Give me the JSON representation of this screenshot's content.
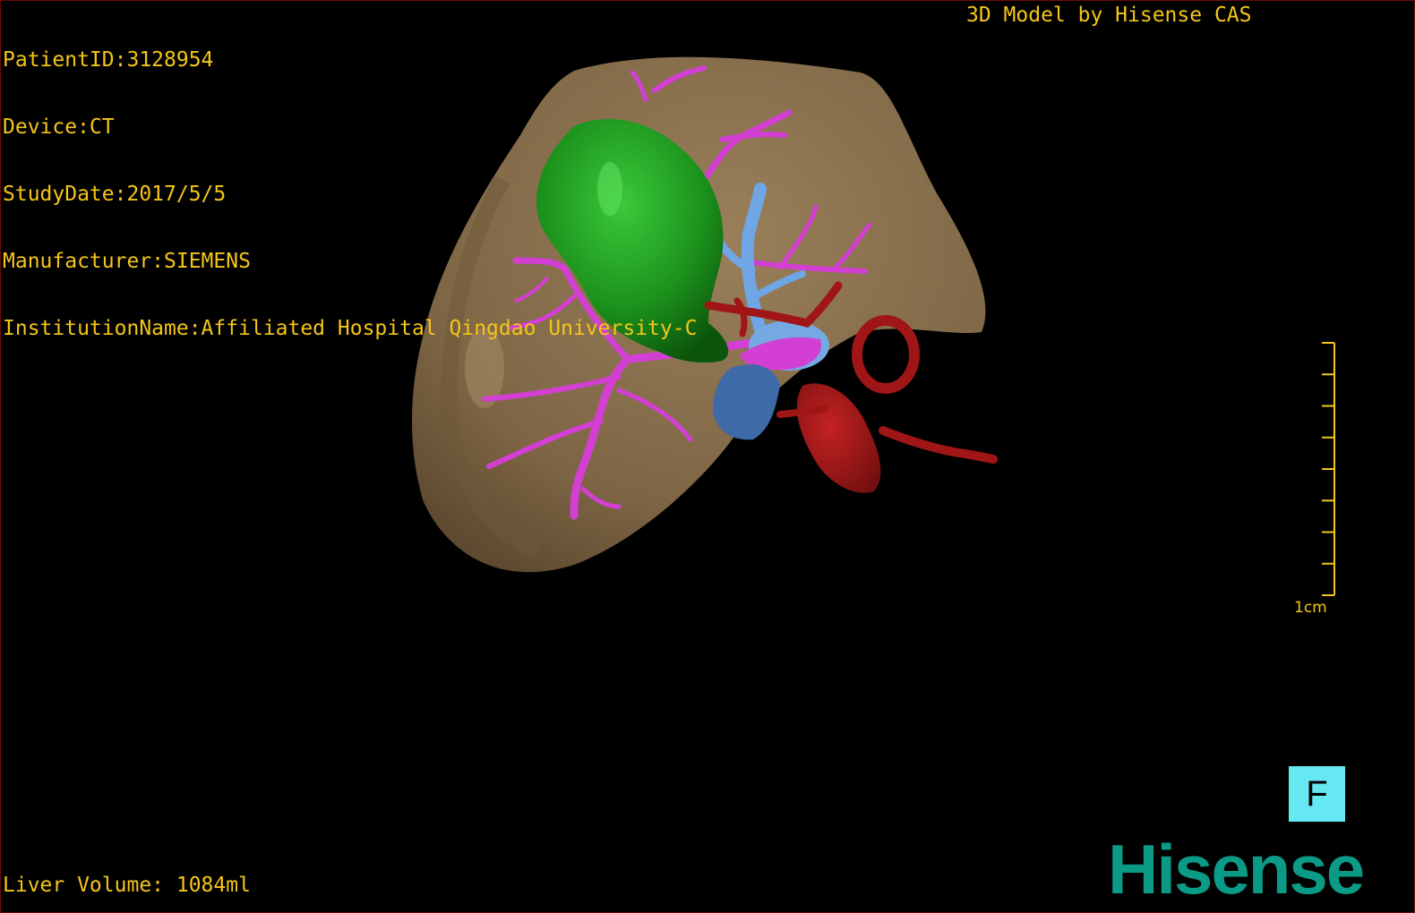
{
  "study_info": {
    "patient_id": "PatientID:3128954",
    "device": "Device:CT",
    "study_date": "StudyDate:2017/5/5",
    "manufacturer": "Manufacturer:SIEMENS",
    "institution": "InstitutionName:Affiliated Hospital Qingdao University-C"
  },
  "header": {
    "model_credit": "3D Model by Hisense CAS"
  },
  "footer": {
    "liver_volume": "Liver Volume: 1084ml"
  },
  "scale_bar": {
    "label": "1cm",
    "ticks": 9
  },
  "orientation_cube": {
    "face": "F"
  },
  "logo": {
    "text": "Hisense"
  },
  "colors": {
    "overlay_text": "#f5c518",
    "liver": "#8a7150",
    "tumor": "#1e9a1e",
    "bile_duct": "#d23fd2",
    "portal_vein": "#6fa6e6",
    "vena_cava": "#3f6aa8",
    "artery": "#a01515",
    "view_cube": "#66e8f3",
    "logo": "#0b9a86"
  }
}
